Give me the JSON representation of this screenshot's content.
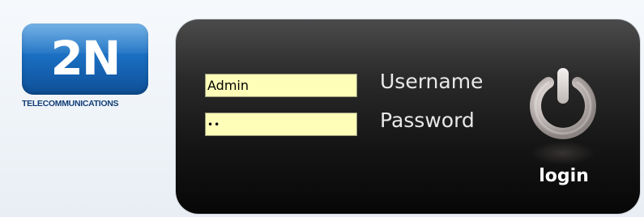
{
  "logo": {
    "mark": "2N",
    "subtitle": "TELECOMMUNICATIONS",
    "brand_color": "#1b6fc2"
  },
  "form": {
    "username_value": "Admin",
    "password_value": "••",
    "username_label": "Username",
    "password_label": "Password",
    "field_background": "#fefeb9"
  },
  "login": {
    "icon": "power-icon",
    "label": "login"
  }
}
